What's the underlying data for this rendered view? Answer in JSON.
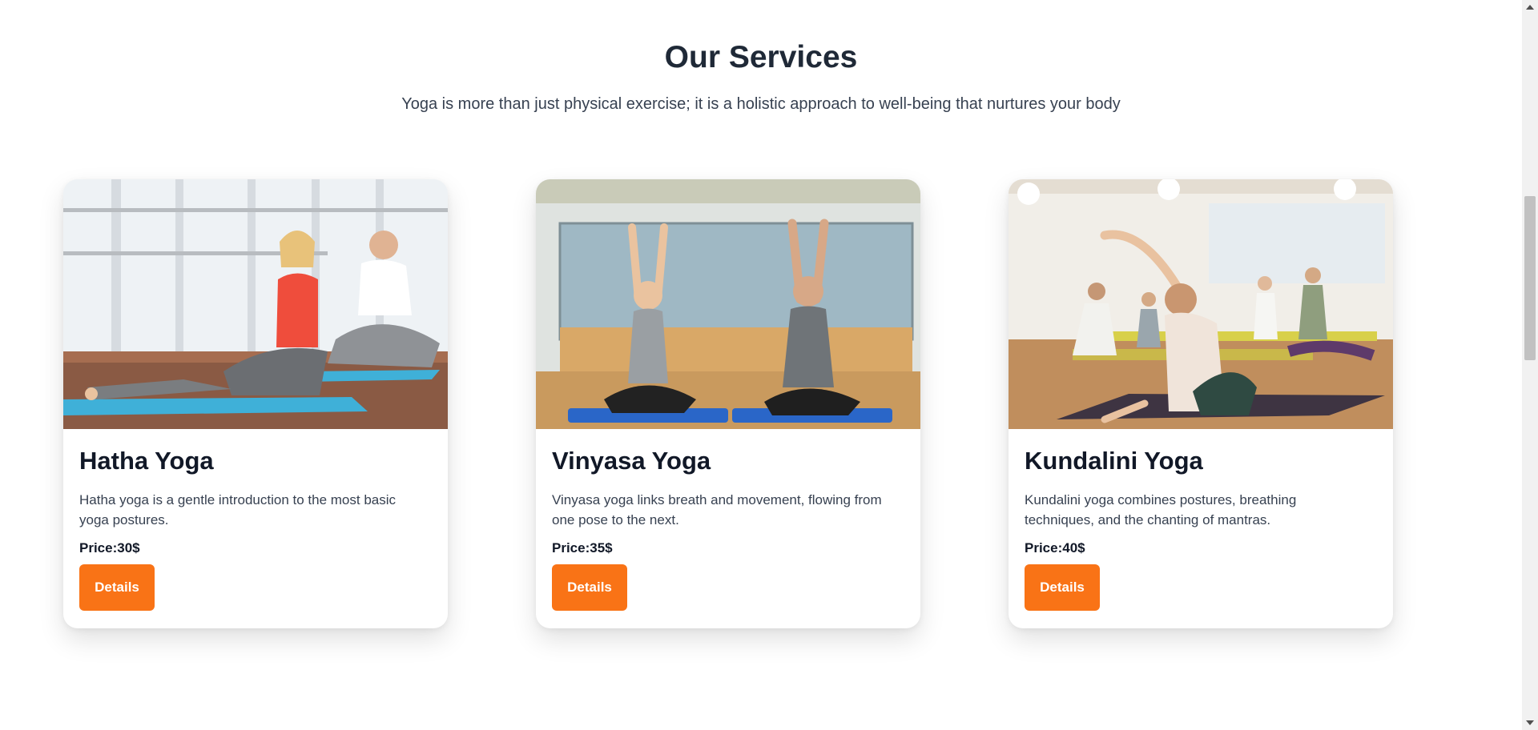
{
  "section": {
    "title": "Our Services",
    "subtitle": "Yoga is more than just physical exercise; it is a holistic approach to well-being that nurtures your body"
  },
  "cards": [
    {
      "title": "Hatha Yoga",
      "description": "Hatha yoga is a gentle introduction to the most basic yoga postures.",
      "price": "Price:30$",
      "button_label": "Details",
      "image": "two people in seated twist pose on blue mats in bright studio"
    },
    {
      "title": "Vinyasa Yoga",
      "description": "Vinyasa yoga links breath and movement, flowing from one pose to the next.",
      "price": "Price:35$",
      "button_label": "Details",
      "image": "man and woman in cross-legged pose with arms raised, palms together"
    },
    {
      "title": "Kundalini Yoga",
      "description": "Kundalini yoga combines postures, breathing techniques, and the chanting of mantras.",
      "price": "Price:40$",
      "button_label": "Details",
      "image": "group class doing side stretches on mats"
    }
  ],
  "colors": {
    "accent": "#f97316",
    "heading": "#1f2937",
    "text": "#374151"
  }
}
